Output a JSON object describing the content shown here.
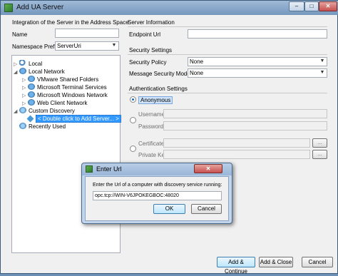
{
  "window": {
    "title": "Add UA Server",
    "controls": [
      "–",
      "□",
      "✕"
    ]
  },
  "left": {
    "section_title": "Integration of the Server in the Address Space",
    "name_label": "Name",
    "name_value": "",
    "prefix_label": "Namespace Prefix",
    "prefix_value": "ServerUri",
    "tree": [
      {
        "label": "Local",
        "icon": "search-icon"
      },
      {
        "label": "Local Network",
        "icon": "network-icon"
      },
      {
        "label": "VMware Shared Folders",
        "icon": "network-icon"
      },
      {
        "label": "Microsoft Terminal Services",
        "icon": "network-icon"
      },
      {
        "label": "Microsoft Windows Network",
        "icon": "network-icon"
      },
      {
        "label": "Web Client Network",
        "icon": "network-icon"
      },
      {
        "label": "Custom Discovery",
        "icon": "globe-icon"
      },
      {
        "label": "< Double click to Add Server... >",
        "icon": "diamond-icon"
      },
      {
        "label": "Recently Used",
        "icon": "globe-icon"
      }
    ]
  },
  "right": {
    "server_info_title": "Server Information",
    "endpoint_label": "Endpoint Url",
    "endpoint_value": "",
    "security_title": "Security Settings",
    "policy_label": "Security Policy",
    "policy_value": "None",
    "mode_label": "Message Security Mode",
    "mode_value": "None",
    "auth_title": "Authentication Settings",
    "anonymous_label": "Anonymous",
    "username_label": "Username",
    "password_label": "Password",
    "certificate_label": "Certificate",
    "private_key_label": "Private Key",
    "browse_label": "..."
  },
  "footer": {
    "add_continue": "Add & Continue",
    "add_close": "Add & Close",
    "cancel": "Cancel"
  },
  "dialog": {
    "title": "Enter Url",
    "prompt": "Enter the Url of a computer with discovery service running:",
    "url_value": "opc.tcp://WIN-V6JPOKEGBOC:48020",
    "ok": "OK",
    "cancel": "Cancel",
    "close": "✕"
  },
  "colors": {
    "selection": "#3399ff",
    "titlebar": "#7597bd",
    "close_button": "#c75050"
  }
}
